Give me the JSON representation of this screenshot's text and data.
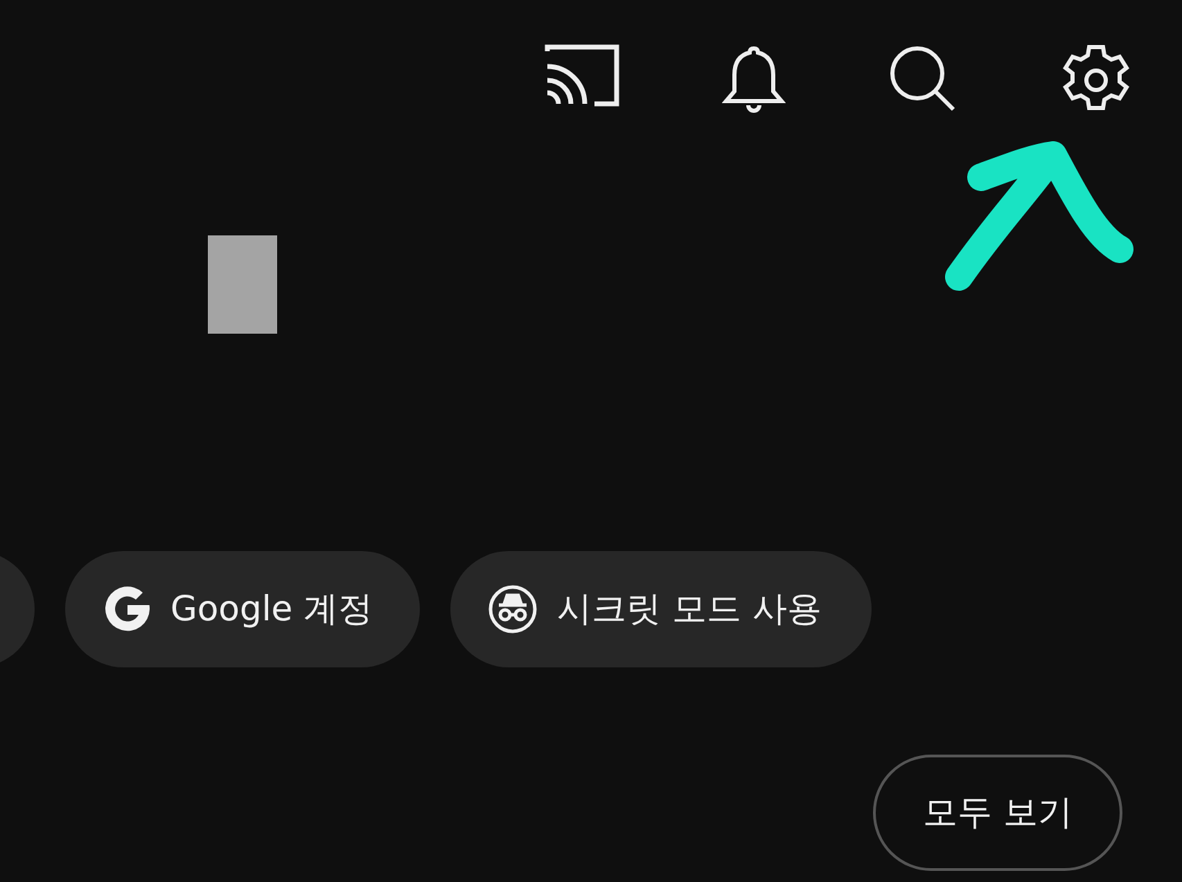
{
  "chips": [
    {
      "kind": "partial"
    },
    {
      "kind": "google",
      "label": "Google 계정"
    },
    {
      "kind": "incognito",
      "label": "시크릿 모드 사용"
    }
  ],
  "view_all_button": "모두 보기"
}
